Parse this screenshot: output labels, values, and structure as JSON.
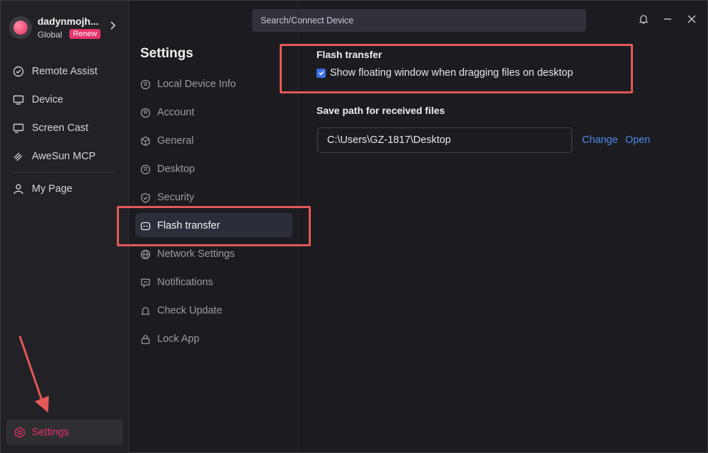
{
  "profile": {
    "username": "dadynmojh...",
    "region": "Global",
    "badge": "Renew"
  },
  "sidebar": {
    "items": [
      {
        "label": "Remote Assist",
        "icon": "remote-assist-icon"
      },
      {
        "label": "Device",
        "icon": "monitor-icon"
      },
      {
        "label": "Screen Cast",
        "icon": "screen-cast-icon"
      },
      {
        "label": "AweSun MCP",
        "icon": "mcp-icon"
      },
      {
        "label": "My Page",
        "icon": "user-icon"
      }
    ],
    "settings_label": "Settings"
  },
  "search": {
    "placeholder": "Search/Connect Device"
  },
  "settings": {
    "title": "Settings",
    "items": [
      {
        "label": "Local Device Info"
      },
      {
        "label": "Account"
      },
      {
        "label": "General"
      },
      {
        "label": "Desktop"
      },
      {
        "label": "Security"
      },
      {
        "label": "Flash transfer"
      },
      {
        "label": "Network Settings"
      },
      {
        "label": "Notifications"
      },
      {
        "label": "Check Update"
      },
      {
        "label": "Lock App"
      }
    ],
    "active": "Flash transfer"
  },
  "content": {
    "section_title": "Flash transfer",
    "checkbox_label": "Show floating window when dragging files on desktop",
    "checkbox_checked": true,
    "save_path_title": "Save path for received files",
    "save_path_value": "C:\\Users\\GZ-1817\\Desktop",
    "change_label": "Change",
    "open_label": "Open"
  },
  "colors": {
    "accent": "#e6336a",
    "link": "#4f86e8",
    "checkbox": "#3b6fe0",
    "annotation": "#e45858"
  }
}
